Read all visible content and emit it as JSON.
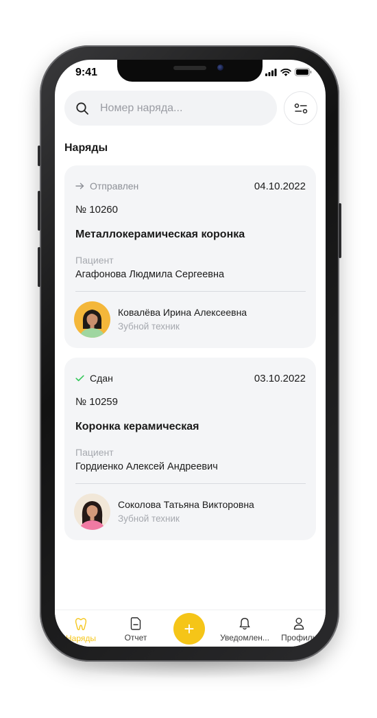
{
  "status_bar": {
    "time": "9:41"
  },
  "search": {
    "placeholder": "Номер наряда..."
  },
  "section_title": "Наряды",
  "orders": [
    {
      "status": "Отправлен",
      "status_icon": "arrow-right-icon",
      "date": "04.10.2022",
      "number": "№ 10260",
      "title": "Металлокерамическая коронка",
      "patient_label": "Пациент",
      "patient_name": "Агафонова Людмила Сергеевна",
      "technician_name": "Ковалёва Ирина Алексеевна",
      "technician_role": "Зубной техник",
      "avatar_bg": "#f4b73a"
    },
    {
      "status": "Сдан",
      "status_icon": "check-icon",
      "date": "03.10.2022",
      "number": "№ 10259",
      "title": "Коронка керамическая",
      "patient_label": "Пациент",
      "patient_name": "Гордиенко Алексей Андреевич",
      "technician_name": "Соколова Татьяна Викторовна",
      "technician_role": "Зубной техник",
      "avatar_bg": "#f1e7d8"
    }
  ],
  "tabbar": {
    "items": [
      {
        "label": "Наряды",
        "icon": "tooth-icon",
        "active": true
      },
      {
        "label": "Отчет",
        "icon": "document-icon",
        "active": false
      },
      {
        "label": "Уведомлен...",
        "icon": "bell-icon",
        "active": false
      },
      {
        "label": "Профиль",
        "icon": "user-icon",
        "active": false
      }
    ],
    "fab_label": "+"
  },
  "colors": {
    "accent": "#f5c518",
    "card_bg": "#f4f5f7",
    "muted_text": "#a5a8ae",
    "success": "#34c759"
  }
}
